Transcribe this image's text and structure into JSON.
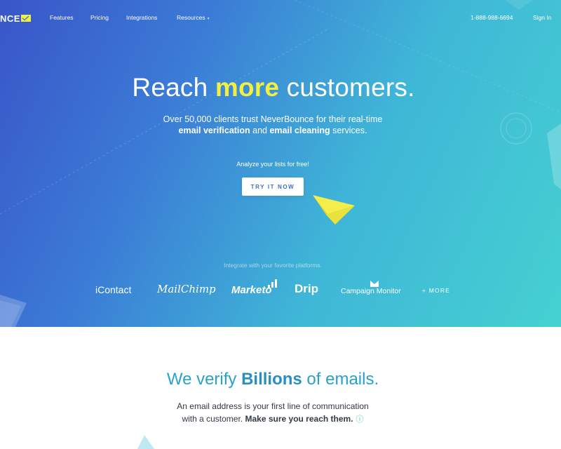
{
  "nav": {
    "logo_text": "NCE",
    "links": [
      "Features",
      "Pricing",
      "Integrations",
      "Resources"
    ],
    "phone": "1-888-988-6694",
    "signin": "Sign In"
  },
  "hero": {
    "headline_pre": "Reach ",
    "headline_highlight": "more",
    "headline_post": " customers.",
    "sub_line1": "Over 50,000 clients trust NeverBounce for their real-time",
    "sub_bold1": "email verification",
    "sub_mid": " and ",
    "sub_bold2": "email cleaning",
    "sub_end": " services.",
    "analyze": "Analyze your lists for free!",
    "cta_label": "TRY IT NOW",
    "integrate_label": "Integrate with your favorite platforms.",
    "platforms": {
      "icontact": "iContact",
      "mailchimp": "MailChimp",
      "marketo": "Marketo",
      "drip": "Drip",
      "campaign_monitor": "Campaign Monitor",
      "more": "+ MORE"
    }
  },
  "section": {
    "title_pre": "We verify ",
    "title_bold": "Billions",
    "title_post": " of emails.",
    "desc_line1": "An email address is your first line of communication",
    "desc_line2_pre": "with a customer.  ",
    "desc_line2_bold": "Make sure you reach them.",
    "info_icon": "ⓘ"
  },
  "colors": {
    "accent_yellow": "#f2ee42",
    "brand_blue": "#2aa1cc",
    "gradient_start": "#3a55c8",
    "gradient_end": "#45d1d1"
  }
}
